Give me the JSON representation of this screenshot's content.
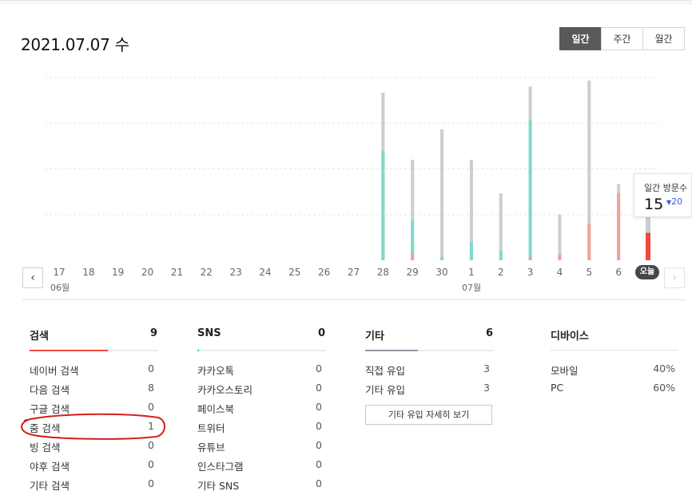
{
  "header": {
    "date": "2021.07.07 수",
    "period_tabs": [
      {
        "label": "일간",
        "active": true
      },
      {
        "label": "주간",
        "active": false
      },
      {
        "label": "월간",
        "active": false
      }
    ]
  },
  "chart_data": {
    "type": "bar",
    "categories": [
      "17",
      "18",
      "19",
      "20",
      "21",
      "22",
      "23",
      "24",
      "25",
      "26",
      "27",
      "28",
      "29",
      "30",
      "1",
      "2",
      "3",
      "4",
      "5",
      "6",
      "오늘"
    ],
    "month_labels": [
      "06월",
      "07월"
    ],
    "ylim": [
      0,
      60
    ],
    "series": [
      {
        "color": "#c8ced3",
        "values": [
          0,
          0,
          0,
          0,
          0,
          0,
          0,
          0,
          0,
          0,
          0,
          55,
          33,
          43,
          33,
          22,
          57,
          15,
          59,
          25,
          15
        ]
      },
      {
        "color": "#7edbc9",
        "values": [
          0,
          0,
          0,
          0,
          0,
          0,
          0,
          0,
          0,
          0,
          0,
          36,
          13,
          1,
          6,
          3,
          46,
          2,
          1,
          1,
          0
        ]
      },
      {
        "color": "#f0a29a",
        "values": [
          0,
          0,
          0,
          0,
          0,
          0,
          0,
          0,
          0,
          0,
          0,
          0,
          2,
          0,
          0,
          0,
          1,
          2,
          12,
          22,
          0
        ]
      },
      {
        "color": "#f04a3d",
        "values": [
          0,
          0,
          0,
          0,
          0,
          0,
          0,
          0,
          0,
          0,
          0,
          0,
          0,
          0,
          0,
          0,
          0,
          0,
          0,
          0,
          9
        ]
      }
    ],
    "grid": true
  },
  "tooltip": {
    "title": "일간 방문수",
    "value": "15",
    "prev": "20"
  },
  "nav": {
    "prev_icon": "chevron-left-icon",
    "next_icon": "chevron-right-icon"
  },
  "stats": {
    "search": {
      "title": "검색",
      "count": "9",
      "color": "#f04a3d",
      "fill": 0.6,
      "rows": [
        {
          "label": "네이버 검색",
          "value": "0"
        },
        {
          "label": "다음 검색",
          "value": "8"
        },
        {
          "label": "구글 검색",
          "value": "0"
        },
        {
          "label": "줌 검색",
          "value": "1"
        },
        {
          "label": "빙 검색",
          "value": "0"
        },
        {
          "label": "야후 검색",
          "value": "0"
        },
        {
          "label": "기타 검색",
          "value": "0"
        }
      ]
    },
    "sns": {
      "title": "SNS",
      "count": "0",
      "color": "#2ec5b0",
      "fill": 0.01,
      "rows": [
        {
          "label": "카카오톡",
          "value": "0"
        },
        {
          "label": "카카오스토리",
          "value": "0"
        },
        {
          "label": "페이스북",
          "value": "0"
        },
        {
          "label": "트위터",
          "value": "0"
        },
        {
          "label": "유튜브",
          "value": "0"
        },
        {
          "label": "인스타그램",
          "value": "0"
        },
        {
          "label": "기타 SNS",
          "value": "0"
        }
      ]
    },
    "other": {
      "title": "기타",
      "count": "6",
      "color": "#8f97a3",
      "fill": 0.4,
      "rows": [
        {
          "label": "직접 유입",
          "value": "3"
        },
        {
          "label": "기타 유입",
          "value": "3"
        }
      ],
      "more_label": "기타 유입 자세히 보기"
    },
    "device": {
      "title": "디바이스",
      "rows": [
        {
          "label": "모바일",
          "value": "40%"
        },
        {
          "label": "PC",
          "value": "60%"
        }
      ]
    }
  }
}
